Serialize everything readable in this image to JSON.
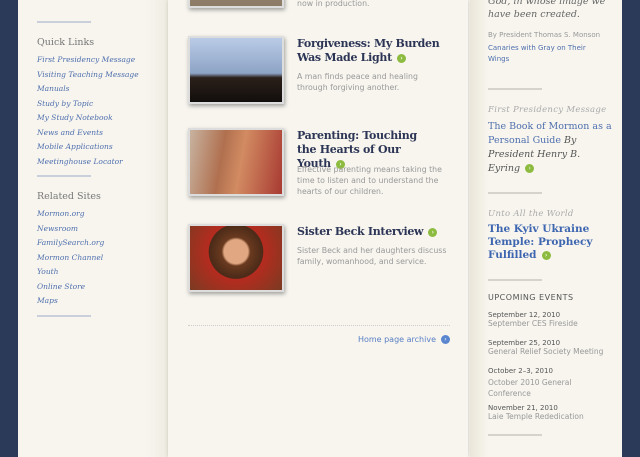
{
  "left": {
    "quick_links_title": "Quick Links",
    "quick_links": [
      "First Presidency Message",
      "Visiting Teaching Message",
      "Manuals",
      "Study by Topic",
      "My Study Notebook",
      "News and Events",
      "Mobile Applications",
      "Meetinghouse Locator"
    ],
    "related_title": "Related Sites",
    "related": [
      "Mormon.org",
      "Newsroom",
      "FamilySearch.org",
      "Mormon Channel",
      "Youth",
      "Online Store",
      "Maps"
    ]
  },
  "main": {
    "prev_desc": "now in production.",
    "items": [
      {
        "title": "Forgiveness: My Burden Was Made Light",
        "desc": "A man finds peace and healing through forgiving another."
      },
      {
        "title": "Parenting: Touching the Hearts of Our Youth",
        "desc": "Effective parenting means taking the time to listen and to understand the hearts of our children."
      },
      {
        "title": "Sister Beck Interview",
        "desc": "Sister Beck and her daughters discuss family, womanhood, and service."
      }
    ],
    "archive": "Home page archive"
  },
  "right": {
    "quote_line1": "God, in whose image we",
    "quote_line2": "have been created.",
    "byline": "By President Thomas S. Monson",
    "byline_link": "Canaries with Gray on Their Wings",
    "fp_category": "First Presidency Message",
    "fp_title": "The Book of Mormon as a Personal Guide",
    "fp_author": "By President Henry B. Eyring",
    "world_category": "Unto All the World",
    "world_title": "The Kyiv Ukraine Temple: Prophecy Fulfilled",
    "events_title": "UPCOMING EVENTS",
    "events": [
      {
        "date": "September 12, 2010",
        "name": "September CES Fireside"
      },
      {
        "date": "September 25, 2010",
        "name": "General Relief Society Meeting"
      },
      {
        "date": "October 2–3, 2010",
        "name": "October 2010 General Conference"
      },
      {
        "date": "November 21, 2010",
        "name": "Laie Temple Rededication"
      }
    ]
  },
  "colors": {
    "background": "#2b3a59",
    "page": "#f7f5ee",
    "link": "#4f6fae",
    "go": "#8dbb3f"
  }
}
